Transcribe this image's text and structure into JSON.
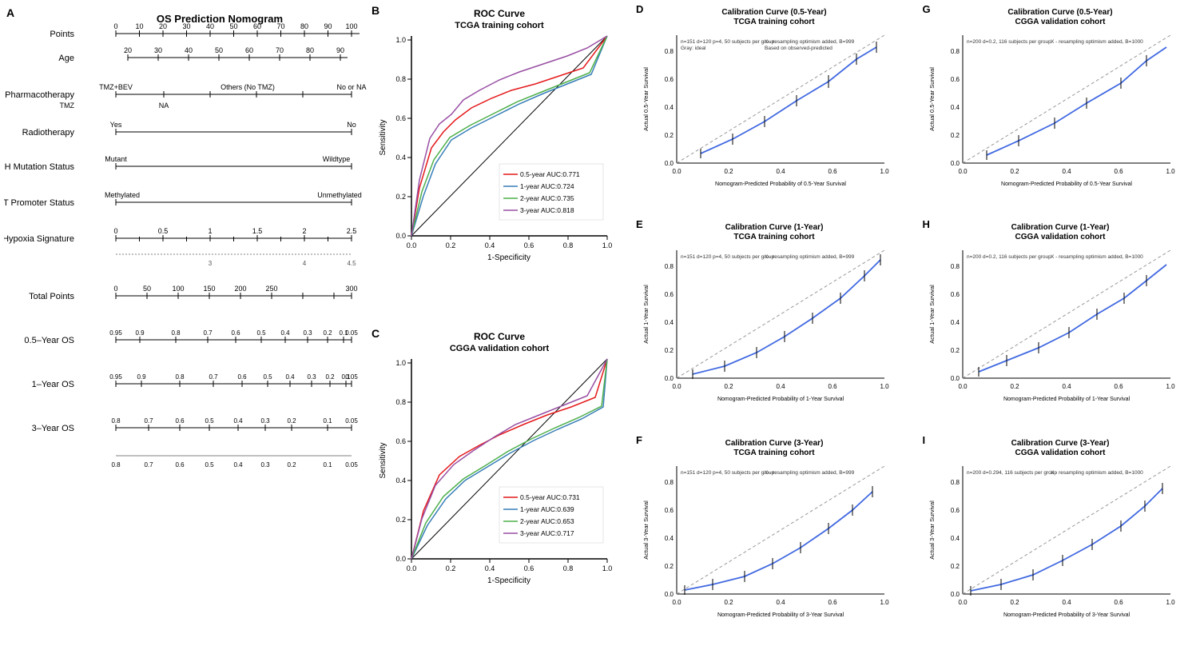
{
  "panels": {
    "a_label": "A",
    "b_label": "B",
    "c_label": "C",
    "d_label": "D",
    "e_label": "E",
    "f_label": "F",
    "g_label": "G",
    "h_label": "H",
    "i_label": "I"
  },
  "nomogram": {
    "title": "OS Prediction Nomogram",
    "rows": [
      {
        "label": "Points"
      },
      {
        "label": "Age"
      },
      {
        "label": "Pharmacotherapy"
      },
      {
        "label": "Radiotherapy"
      },
      {
        "label": "IDH Mutation Status"
      },
      {
        "label": "MGMT Promoter Status"
      },
      {
        "label": "Hypoxia Signature"
      },
      {
        "label": "Total Points"
      },
      {
        "label": "0.5–Year OS"
      },
      {
        "label": "1–Year OS"
      },
      {
        "label": "3–Year OS"
      }
    ]
  },
  "roc_b": {
    "title1": "ROC Curve",
    "title2": "TCGA training cohort",
    "legend": [
      {
        "label": "0.5-year AUC:0.771",
        "color": "#e41a1c"
      },
      {
        "label": "1-year    AUC:0.724",
        "color": "#377eb8"
      },
      {
        "label": "2-year    AUC:0.735",
        "color": "#4daf4a"
      },
      {
        "label": "3-year   AUC:0.818",
        "color": "#984ea3"
      }
    ],
    "x_label": "1-Specificity",
    "y_label": "Sensitivity"
  },
  "roc_c": {
    "title1": "ROC Curve",
    "title2": "CGGA validation cohort",
    "legend": [
      {
        "label": "0.5-year AUC:0.731",
        "color": "#e41a1c"
      },
      {
        "label": "1-year    AUC:0.639",
        "color": "#377eb8"
      },
      {
        "label": "2-year    AUC:0.653",
        "color": "#4daf4a"
      },
      {
        "label": "3-year   AUC:0.717",
        "color": "#984ea3"
      }
    ],
    "x_label": "1-Specificity",
    "y_label": "Sensitivity"
  },
  "cal_panels": [
    {
      "id": "D",
      "title1": "Calibration Curve (0.5-Year)",
      "title2": "TCGA training cohort",
      "x_label": "Nomogram-Predicted Probability of 0.5-Year Survival"
    },
    {
      "id": "G",
      "title1": "Calibration Curve (0.5-Year)",
      "title2": "CGGA validation cohort",
      "x_label": "Nomogram-Predicted Probability of 0.5-Year Survival"
    },
    {
      "id": "E",
      "title1": "Calibration Curve (1-Year)",
      "title2": "TCGA training cohort",
      "x_label": "Nomogram-Predicted Probability of 1-Year Survival"
    },
    {
      "id": "H",
      "title1": "Calibration Curve (1-Year)",
      "title2": "CGGA validation cohort",
      "x_label": "Nomogram-Predicted Probability of 1-Year Survival"
    },
    {
      "id": "F",
      "title1": "Calibration Curve (3-Year)",
      "title2": "TCGA training cohort",
      "x_label": "Nomogram-Predicted Probability of 3-Year Survival"
    },
    {
      "id": "I",
      "title1": "Calibration Curve (3-Year)",
      "title2": "CGGA validation cohort",
      "x_label": "Nomogram-Predicted Probability of 3-Year Survival"
    }
  ]
}
